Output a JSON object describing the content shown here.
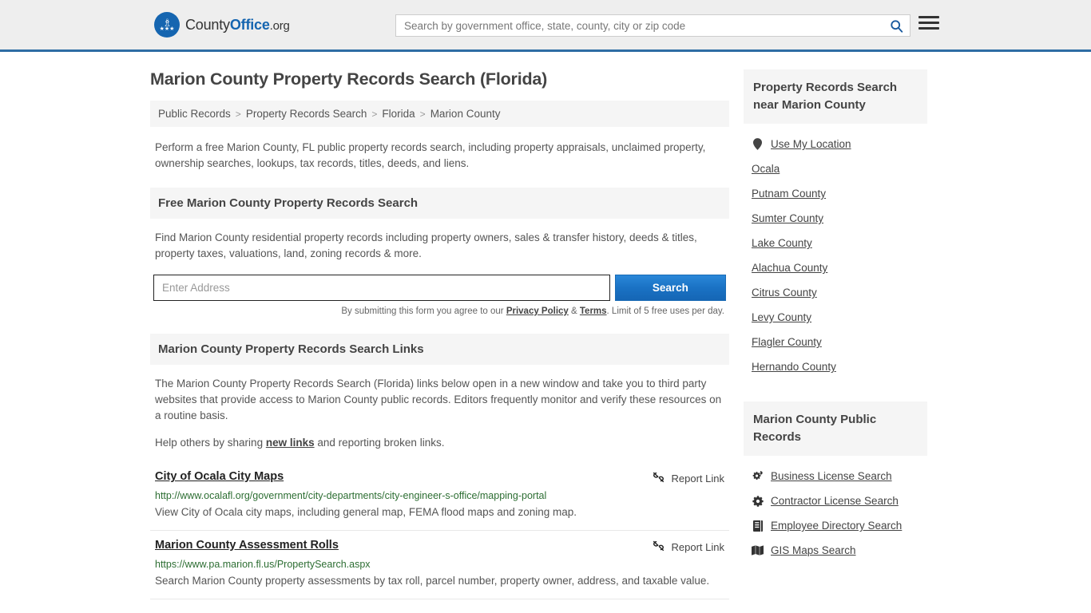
{
  "header": {
    "logo": {
      "part1": "County",
      "part2": "Office",
      "part3": ".org"
    },
    "search_placeholder": "Search by government office, state, county, city or zip code",
    "search_value": "",
    "search_icon": "magnifier-icon",
    "menu_icon": "hamburger-menu-icon"
  },
  "page": {
    "title": "Marion County Property Records Search (Florida)",
    "breadcrumb": [
      {
        "label": "Public Records"
      },
      {
        "label": "Property Records Search"
      },
      {
        "label": "Florida"
      },
      {
        "label": "Marion County"
      }
    ],
    "breadcrumb_separator": ">",
    "intro": "Perform a free Marion County, FL public property records search, including property appraisals, unclaimed property, ownership searches, lookups, tax records, titles, deeds, and liens."
  },
  "free_search": {
    "heading": "Free Marion County Property Records Search",
    "description": "Find Marion County residential property records including property owners, sales & transfer history, deeds & titles, property taxes, valuations, land, zoning records & more.",
    "input_placeholder": "Enter Address",
    "input_value": "",
    "button_label": "Search",
    "note_prefix": "By submitting this form you agree to our ",
    "note_privacy": "Privacy Policy",
    "note_amp": " & ",
    "note_terms": "Terms",
    "note_suffix": ". Limit of 5 free uses per day."
  },
  "links_section": {
    "heading": "Marion County Property Records Search Links",
    "paragraph": "The Marion County Property Records Search (Florida) links below open in a new window and take you to third party websites that provide access to Marion County public records. Editors frequently monitor and verify these resources on a routine basis.",
    "help_prefix": "Help others by sharing ",
    "help_link": "new links",
    "help_suffix": " and reporting broken links.",
    "report_label": "Report Link",
    "report_icon": "broken-link-icon",
    "entries": [
      {
        "title": "City of Ocala City Maps",
        "url": "http://www.ocalafl.org/government/city-departments/city-engineer-s-office/mapping-portal",
        "description": "View City of Ocala city maps, including general map, FEMA flood maps and zoning map."
      },
      {
        "title": "Marion County Assessment Rolls",
        "url": "https://www.pa.marion.fl.us/PropertySearch.aspx",
        "description": "Search Marion County property assessments by tax roll, parcel number, property owner, address, and taxable value."
      }
    ]
  },
  "sidebar": {
    "nearby": {
      "heading": "Property Records Search near Marion County",
      "items": [
        {
          "label": "Use My Location",
          "icon": "map-pin-icon"
        },
        {
          "label": "Ocala",
          "icon": ""
        },
        {
          "label": "Putnam County",
          "icon": ""
        },
        {
          "label": "Sumter County",
          "icon": ""
        },
        {
          "label": "Lake County",
          "icon": ""
        },
        {
          "label": "Alachua County",
          "icon": ""
        },
        {
          "label": "Citrus County",
          "icon": ""
        },
        {
          "label": "Levy County",
          "icon": ""
        },
        {
          "label": "Flagler County",
          "icon": ""
        },
        {
          "label": "Hernando County",
          "icon": ""
        }
      ]
    },
    "public_records": {
      "heading": "Marion County Public Records",
      "items": [
        {
          "label": "Business License Search",
          "icon": "cogs-icon"
        },
        {
          "label": "Contractor License Search",
          "icon": "cog-icon"
        },
        {
          "label": "Employee Directory Search",
          "icon": "book-icon"
        },
        {
          "label": "GIS Maps Search",
          "icon": "map-icon"
        }
      ]
    }
  },
  "colors": {
    "brand_blue": "#1565b0",
    "header_border": "#2e6da4",
    "button_blue": "#1a72c4",
    "url_green": "#2d6e33",
    "panel_gray": "#f5f5f5",
    "header_gray": "#eeeeee"
  }
}
